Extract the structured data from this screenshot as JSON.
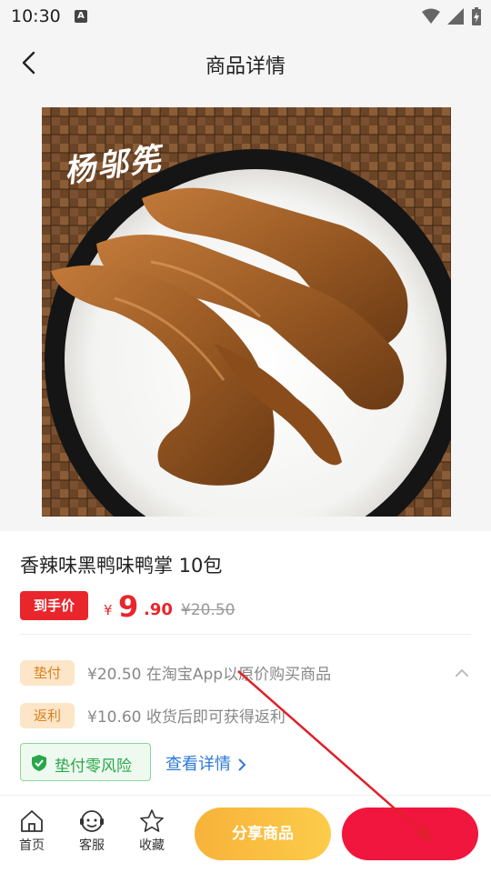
{
  "status_bar": {
    "time": "10:30",
    "notification_icon": "a-icon",
    "icons": [
      "wifi-icon",
      "signal-icon",
      "battery-charging-icon"
    ]
  },
  "navbar": {
    "back_icon": "chevron-left-icon",
    "title": "商品详情"
  },
  "product": {
    "image_watermark": "杨邬筅",
    "title": "香辣味黑鸭味鸭掌 10包",
    "price_badge": "到手价",
    "currency": "¥",
    "price_integer": "9",
    "price_decimal": ".90",
    "original_price": "¥20.50"
  },
  "rows": [
    {
      "tag": "垫付",
      "text": "¥20.50 在淘宝App以原价购买商品"
    },
    {
      "tag": "返利",
      "text": "¥10.60 收货后即可获得返利"
    }
  ],
  "guarantee": {
    "label": "垫付零风险",
    "link": "查看详情"
  },
  "bottom_bar": {
    "home": "首页",
    "service": "客服",
    "favorite": "收藏",
    "share_button": "分享商品",
    "buy_button": ""
  },
  "colors": {
    "accent_red": "#e8262c",
    "buy_red": "#f0163d",
    "share_gold": "#f7b23a",
    "tag_bg": "#fde5c8",
    "tag_text": "#d8801f",
    "safe_green": "#2aa64a",
    "link_blue": "#2d7ad6"
  }
}
